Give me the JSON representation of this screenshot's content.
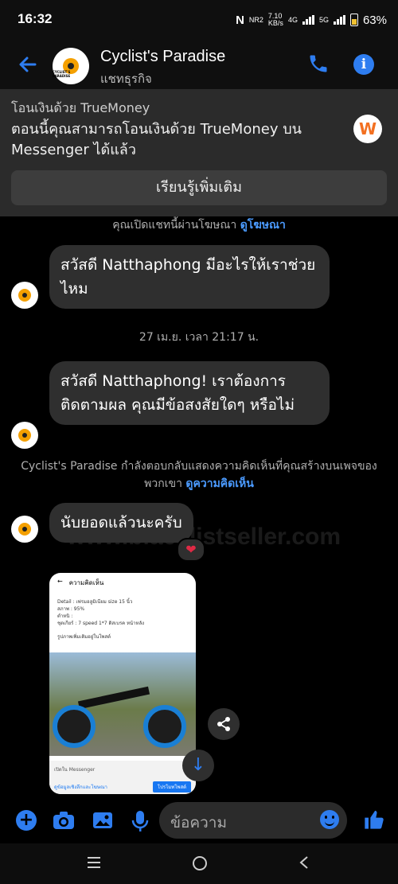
{
  "status_bar": {
    "time": "16:32",
    "network": "NR2",
    "speed": "7.10",
    "speed_unit": "KB/s",
    "net1": "4G",
    "net2": "5G",
    "battery": "63%"
  },
  "header": {
    "title": "Cyclist's Paradise",
    "subtitle": "แชทธุรกิจ",
    "logo_text": "CYCLIST'S PARADISE"
  },
  "banner": {
    "label": "โอนเงินด้วย TrueMoney",
    "text": "ตอนนี้คุณสามารถโอนเงินด้วย TrueMoney บน Messenger ได้แล้ว",
    "button": "เรียนรู้เพิ่มเติม"
  },
  "chat": {
    "ad_notice": "คุณเปิดแชทนี้ผ่านโฆษณา",
    "ad_link": "ดูโฆษณา",
    "msg1": "สวัสดี Natthaphong มีอะไรให้เราช่วยไหม",
    "timestamp": "27 เม.ย. เวลา 21:17 น.",
    "msg2": "สวัสดี Natthaphong! เราต้องการติดตามผล คุณมีข้อสงสัยใดๆ หรือไม่",
    "comment_notice": "Cyclist's Paradise กำลังตอบกลับแสดงความคิดเห็นที่คุณสร้างบนเพจของพวกเขา",
    "comment_link": "ดูความคิดเห็น",
    "msg3": "นับยอดแล้วนะครับ",
    "reaction": "❤",
    "watermark": "www.blacklistseller.com"
  },
  "preview": {
    "header": "ความคิดเห็น",
    "lines": [
      "Detail : เฟรมอลูมิเนียม size 15 นิ้ว",
      "สภาพ : 95%",
      "ตำหนิ :",
      "ชุดเกียร์ : 7 speed 1*7 ดิสเบรค หน้าหลัง"
    ],
    "caption": "รูปภาพเพิ่มเติมอยู่ในโพสต์",
    "footer_text": "เปิดใน Messenger",
    "footer_link": "ดูข้อมูลเชิงลึกและโฆษณา",
    "footer_button": "โปรโมทโพสต์"
  },
  "composer": {
    "placeholder": "ข้อความ"
  }
}
